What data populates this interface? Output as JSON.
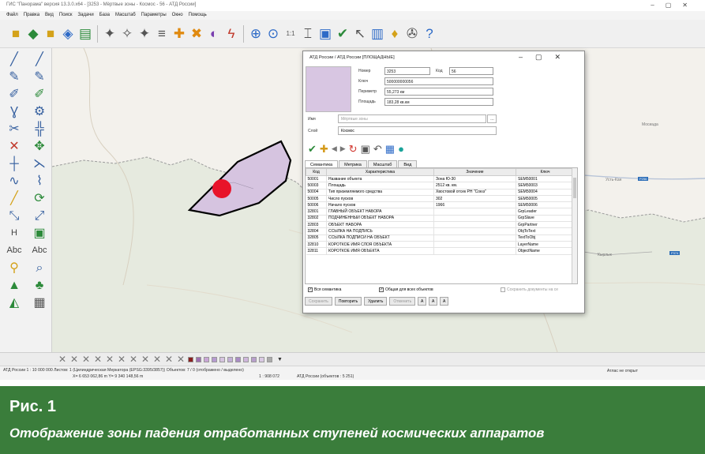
{
  "window": {
    "title": "ГИС \"Панорама\" версия 13.3.0.x64 - [3253 - Мёртвые зоны - Космос - 56 - АТД России]"
  },
  "menu": [
    "Файл",
    "Правка",
    "Вид",
    "Поиск",
    "Задачи",
    "База",
    "Масштаб",
    "Параметры",
    "Окно",
    "Помощь"
  ],
  "toolbar_icons": [
    "folder-open-icon",
    "layers-icon",
    "save-icon",
    "map-icon",
    "print-icon",
    "select-tools-icon",
    "line-icon",
    "point-add-icon",
    "point-remove-icon",
    "palette-icon",
    "lightning-icon",
    "zoom-in-icon",
    "zoom-fit-icon",
    "scale-1-1-label",
    "measure-icon",
    "window-icon",
    "check-icon",
    "pointer-icon",
    "layers-panel-icon",
    "tools-icon",
    "help-icon"
  ],
  "toolbar_label_1to1": "1:1",
  "left_tools_text": {
    "h": "H",
    "abc1": "Abc",
    "abc2": "Abc"
  },
  "map_labels": {
    "city1": "Мосиада",
    "city2": "Усть-Кан",
    "city3": "Кырлык",
    "road1": "Р256",
    "road2": "Р374"
  },
  "zone": {
    "fill": "#d6c4e0",
    "stroke": "#000000",
    "point_color": "#e8142a"
  },
  "dialog": {
    "title": "АТД России / АТД России [ПЛОЩАДНЫЕ]",
    "number_label": "Номер",
    "number": "3253",
    "code_label": "Код",
    "code": "56",
    "key_label": "Ключ",
    "key": "500000000056",
    "perimeter_label": "Периметр",
    "perimeter": "55,273 км",
    "area_label": "Площадь",
    "area": "183,28 кв.км",
    "name_label": "Имя",
    "name_placeholder": "Мёртвые зоны",
    "layer_label": "Слой",
    "layer": "Космос",
    "tabs": [
      "Семантика",
      "Метрика",
      "Масштаб",
      "Вид"
    ],
    "table": {
      "headers": [
        "Код",
        "Характеристика",
        "Значение",
        "Ключ"
      ],
      "rows": [
        [
          "50001",
          "Название объекта",
          "Зона Ю-30",
          "SEM50001"
        ],
        [
          "50003",
          "Площадь",
          "2512 кв. км.",
          "SEM50003"
        ],
        [
          "50004",
          "Тип приземляемого средства",
          "Хвостовой отсек РН \"Союз\"",
          "SEM50004"
        ],
        [
          "50005",
          "Число пусков",
          "302",
          "SEM50005"
        ],
        [
          "50006",
          "Начало пусков",
          "1966",
          "SEM50006"
        ],
        [
          "32801",
          "ГЛАВНЫЙ ОБЪЕКТ НАБОРА",
          "",
          "GrpLeader"
        ],
        [
          "32802",
          "ПОДЧИНЕННЫЙ ОБЪЕКТ НАБОРА",
          "",
          "GrpSlave"
        ],
        [
          "32803",
          "ОБЪЕКТ НАБОРА",
          "",
          "GrpPartner"
        ],
        [
          "32804",
          "ССЫЛКА НА ПОДПИСЬ",
          "",
          "ObjToText"
        ],
        [
          "32805",
          "ССЫЛКА ПОДПИСИ НА ОБЪЕКТ",
          "",
          "TextToObj"
        ],
        [
          "32810",
          "КОРОТКОЕ ИМЯ СЛОЯ ОБЪЕКТА",
          "",
          "LayerName"
        ],
        [
          "32811",
          "КОРОТКОЕ ИМЯ ОБЪЕКТА",
          "",
          "ObjectName"
        ]
      ]
    },
    "all_semantics": "Вся семантика",
    "common_for_all": "Общая для всех объектов",
    "save_docs": "Сохранить документы на се",
    "buttons": {
      "save": "Сохранить",
      "repeat": "Повторить",
      "delete": "Удалить",
      "cancel": "Отменить",
      "a1": "A",
      "a2": "A",
      "a3": "A"
    }
  },
  "status": {
    "line1": "АТД России  1 : 10 000 000  Листов: 1  (Цилиндрическая Меркатора (EPSG:3395/3857))  Объектов: 7 / 0 (отображено / выделено)",
    "coords": "X= 6 653 062,86 m     Y= 9 340 148,56 m",
    "scale": "1 : 908 072",
    "atd": "АТД России  (объектов : 5 251)",
    "atlas": "Атлас не открыт"
  },
  "caption": {
    "number": "Рис. 1",
    "text": "Отображение зоны падения отработанных ступеней космических аппаратов"
  }
}
